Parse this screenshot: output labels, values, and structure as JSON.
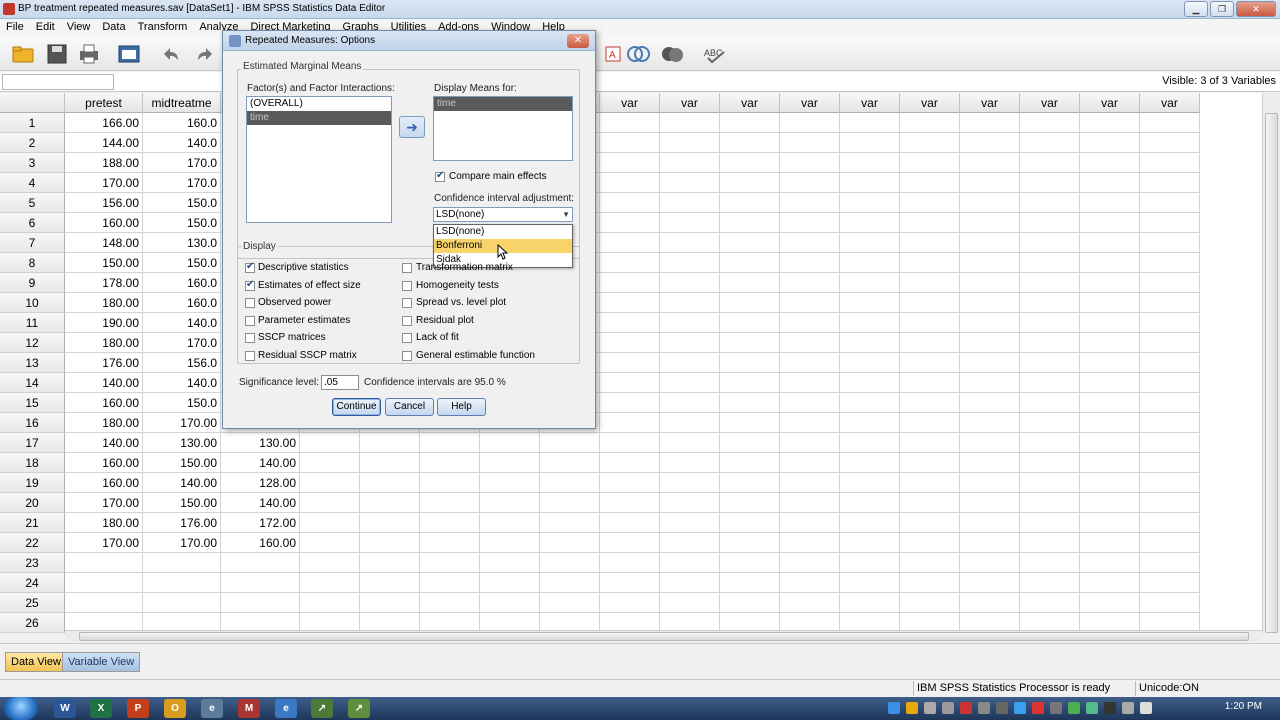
{
  "window": {
    "title": "BP treatment repeated measures.sav [DataSet1] - IBM SPSS Statistics Data Editor"
  },
  "menu": [
    "File",
    "Edit",
    "View",
    "Data",
    "Transform",
    "Analyze",
    "Direct Marketing",
    "Graphs",
    "Utilities",
    "Add-ons",
    "Window",
    "Help"
  ],
  "refbar": {
    "visible": "Visible: 3 of 3 Variables"
  },
  "grid": {
    "columns": [
      "pretest",
      "midtreatme",
      "",
      "var",
      "var",
      "var",
      "var",
      "var",
      "var",
      "var",
      "var",
      "var",
      "var",
      "var",
      "var",
      "var",
      "var",
      "var"
    ],
    "var_label": "var",
    "rows": [
      {
        "n": "1",
        "pretest": "166.00",
        "mid": "160.0",
        "post": ""
      },
      {
        "n": "2",
        "pretest": "144.00",
        "mid": "140.0",
        "post": ""
      },
      {
        "n": "3",
        "pretest": "188.00",
        "mid": "170.0",
        "post": ""
      },
      {
        "n": "4",
        "pretest": "170.00",
        "mid": "170.0",
        "post": ""
      },
      {
        "n": "5",
        "pretest": "156.00",
        "mid": "150.0",
        "post": ""
      },
      {
        "n": "6",
        "pretest": "160.00",
        "mid": "150.0",
        "post": ""
      },
      {
        "n": "7",
        "pretest": "148.00",
        "mid": "130.0",
        "post": ""
      },
      {
        "n": "8",
        "pretest": "150.00",
        "mid": "150.0",
        "post": ""
      },
      {
        "n": "9",
        "pretest": "178.00",
        "mid": "160.0",
        "post": ""
      },
      {
        "n": "10",
        "pretest": "180.00",
        "mid": "160.0",
        "post": ""
      },
      {
        "n": "11",
        "pretest": "190.00",
        "mid": "140.0",
        "post": ""
      },
      {
        "n": "12",
        "pretest": "180.00",
        "mid": "170.0",
        "post": ""
      },
      {
        "n": "13",
        "pretest": "176.00",
        "mid": "156.0",
        "post": ""
      },
      {
        "n": "14",
        "pretest": "140.00",
        "mid": "140.0",
        "post": ""
      },
      {
        "n": "15",
        "pretest": "160.00",
        "mid": "150.0",
        "post": ""
      },
      {
        "n": "16",
        "pretest": "180.00",
        "mid": "170.00",
        "post": ""
      },
      {
        "n": "17",
        "pretest": "140.00",
        "mid": "130.00",
        "post": "130.00"
      },
      {
        "n": "18",
        "pretest": "160.00",
        "mid": "150.00",
        "post": "140.00"
      },
      {
        "n": "19",
        "pretest": "160.00",
        "mid": "140.00",
        "post": "128.00"
      },
      {
        "n": "20",
        "pretest": "170.00",
        "mid": "150.00",
        "post": "140.00"
      },
      {
        "n": "21",
        "pretest": "180.00",
        "mid": "176.00",
        "post": "172.00"
      },
      {
        "n": "22",
        "pretest": "170.00",
        "mid": "170.00",
        "post": "160.00"
      },
      {
        "n": "23",
        "pretest": "",
        "mid": "",
        "post": ""
      },
      {
        "n": "24",
        "pretest": "",
        "mid": "",
        "post": ""
      },
      {
        "n": "25",
        "pretest": "",
        "mid": "",
        "post": ""
      },
      {
        "n": "26",
        "pretest": "",
        "mid": "",
        "post": ""
      }
    ]
  },
  "tabs": {
    "data_view": "Data View",
    "variable_view": "Variable View"
  },
  "status": {
    "processor": "IBM SPSS Statistics Processor is ready",
    "unicode": "Unicode:ON"
  },
  "taskbar": {
    "clock": "1:20 PM"
  },
  "dialog": {
    "title": "Repeated Measures: Options",
    "emm_legend": "Estimated Marginal Means",
    "factors_label": "Factor(s) and Factor Interactions:",
    "factors": [
      "(OVERALL)",
      "time"
    ],
    "display_means_label": "Display Means for:",
    "display_means": [
      "time"
    ],
    "compare_main_effects": "Compare main effects",
    "ci_adjust_label": "Confidence interval adjustment:",
    "ci_adjust_value": "LSD(none)",
    "ci_options": [
      "LSD(none)",
      "Bonferroni",
      "Sidak"
    ],
    "display_legend": "Display",
    "left_checks": [
      {
        "label": "Descriptive statistics",
        "checked": true
      },
      {
        "label": "Estimates of effect size",
        "checked": true
      },
      {
        "label": "Observed power",
        "checked": false
      },
      {
        "label": "Parameter estimates",
        "checked": false
      },
      {
        "label": "SSCP matrices",
        "checked": false
      },
      {
        "label": "Residual SSCP matrix",
        "checked": false
      }
    ],
    "right_checks": [
      {
        "label": "Transformation matrix",
        "checked": false
      },
      {
        "label": "Homogeneity tests",
        "checked": false
      },
      {
        "label": "Spread vs. level plot",
        "checked": false
      },
      {
        "label": "Residual plot",
        "checked": false
      },
      {
        "label": "Lack of fit",
        "checked": false
      },
      {
        "label": "General estimable function",
        "checked": false
      }
    ],
    "significance_label": "Significance level:",
    "significance_value": ".05",
    "ci_text": "Confidence intervals are 95.0 %",
    "continue_label": "Continue",
    "cancel_label": "Cancel",
    "help_label": "Help"
  }
}
